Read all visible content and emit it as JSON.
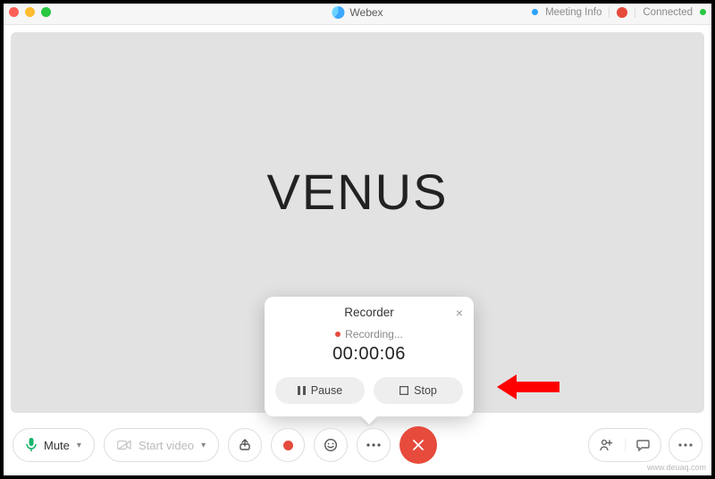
{
  "titlebar": {
    "app_name": "Webex",
    "meeting_info_label": "Meeting Info",
    "connected_label": "Connected"
  },
  "stage": {
    "participant_name": "VENUS"
  },
  "recorder_popover": {
    "title": "Recorder",
    "status_text": "Recording...",
    "elapsed_time": "00:00:06",
    "pause_label": "Pause",
    "stop_label": "Stop"
  },
  "footer": {
    "mute_label": "Mute",
    "start_video_label": "Start video"
  },
  "watermark": "www.deuaq.com"
}
